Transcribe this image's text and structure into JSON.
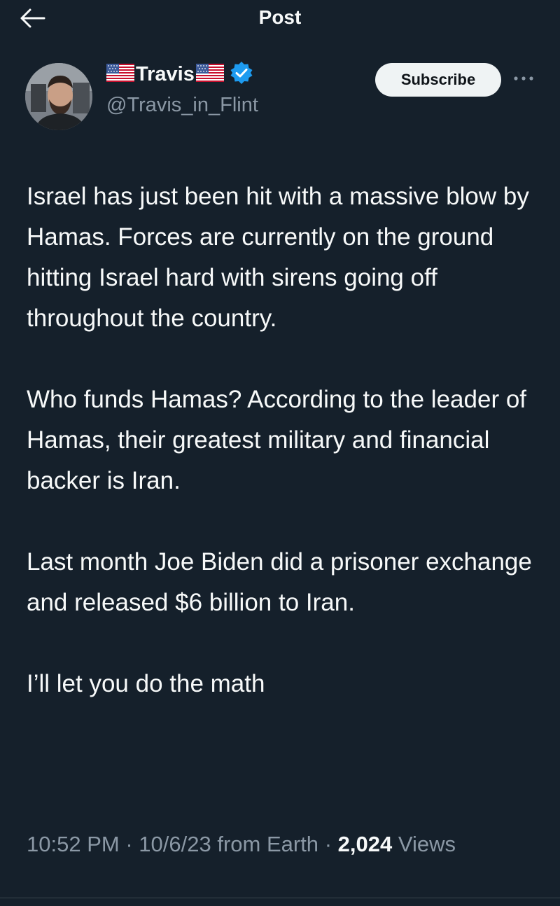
{
  "header": {
    "title": "Post",
    "back_icon": "arrow-left-icon"
  },
  "author": {
    "display_name": "Travis",
    "handle": "@Travis_in_Flint",
    "flag_icon": "us-flag-icon",
    "verified_icon": "verified-badge-icon",
    "verified_color": "#1d9bf0"
  },
  "actions": {
    "subscribe_label": "Subscribe",
    "more_icon": "more-dots-icon"
  },
  "tweet": {
    "paragraphs": [
      "Israel has just been hit with a massive blow by Hamas.  Forces are currently on the ground hitting Israel hard with sirens going off throughout the country.",
      "Who funds Hamas?  According to the leader of Hamas, their greatest military and financial backer is Iran.",
      "Last month Joe Biden did a prisoner exchange and released $6 billion to Iran.",
      "I’ll let you do the math"
    ]
  },
  "meta": {
    "time": "10:52 PM",
    "date": "10/6/23",
    "source": "from Earth",
    "separator": "·",
    "views_count": "2,024",
    "views_label": "Views"
  },
  "colors": {
    "background": "#15202b",
    "text": "#f7f9f9",
    "secondary_text": "#8b98a5",
    "accent": "#1d9bf0"
  }
}
